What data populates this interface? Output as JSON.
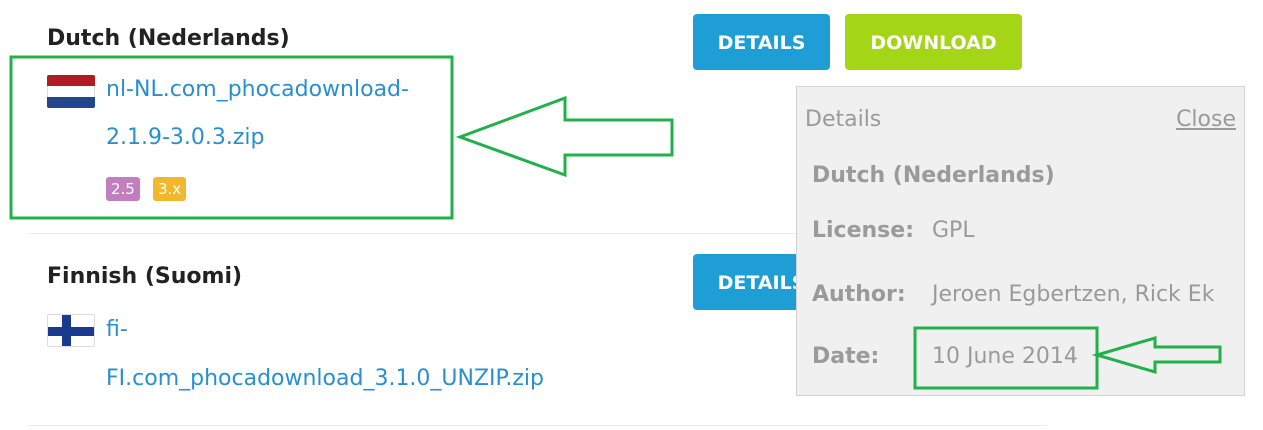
{
  "packages": [
    {
      "language": "Dutch (Nederlands)",
      "flag_icon": "netherlands-flag-icon",
      "file_line1": "nl-NL.com_phocadownload-",
      "file_line2": "2.1.9-3.0.3.zip",
      "badges": [
        {
          "label": "2.5",
          "color": "#c17fc0"
        },
        {
          "label": "3.x",
          "color": "#f0b72f"
        }
      ],
      "details_label": "DETAILS",
      "download_label": "DOWNLOAD"
    },
    {
      "language": "Finnish (Suomi)",
      "flag_icon": "finland-flag-icon",
      "file_line1": "fi-",
      "file_line2": "FI.com_phocadownload_3.1.0_UNZIP.zip",
      "details_label": "DETAILS"
    }
  ],
  "popup": {
    "title": "Details",
    "close_label": "Close",
    "heading": "Dutch (Nederlands)",
    "license_label": "License:",
    "license_value": "GPL",
    "author_label": "Author:",
    "author_value": "Jeroen Egbertzen, Rick Ek",
    "date_label": "Date:",
    "date_value": "10 June 2014"
  },
  "colors": {
    "annotation": "#22b04b",
    "details_button": "#1f9ed6",
    "download_button": "#a4d617",
    "link": "#2a8fd0"
  }
}
